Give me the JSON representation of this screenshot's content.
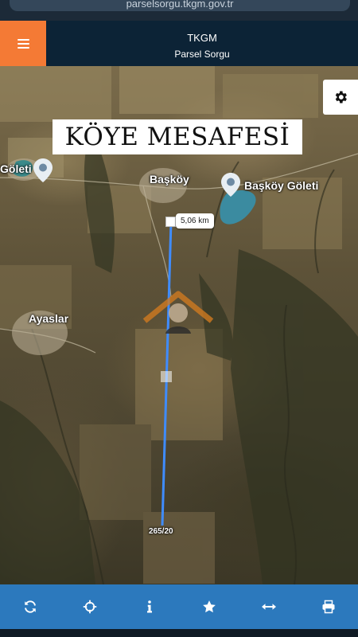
{
  "browser": {
    "url_text": "parselsorgu.tkgm.gov.tr"
  },
  "header": {
    "title": "TKGM",
    "subtitle": "Parsel Sorgu",
    "menu_icon": "hamburger-menu-icon",
    "menu_color": "#f47a35",
    "background_color": "#0c2336"
  },
  "map": {
    "banner_text": "KÖYE MESAFESİ",
    "places": [
      {
        "id": "goleti-west",
        "label": "Göleti"
      },
      {
        "id": "baskoy",
        "label": "Başköy"
      },
      {
        "id": "baskoy-goleti",
        "label": "Başköy Göleti"
      },
      {
        "id": "ayaslar",
        "label": "Ayaslar"
      }
    ],
    "measurement": {
      "distance": "5,06 km",
      "line_color": "#3f8cff"
    },
    "parcel_label": "265/20",
    "settings_icon": "gear-icon"
  },
  "toolbar": {
    "background_color": "#2c79bd",
    "buttons": [
      {
        "name": "refresh",
        "icon": "refresh-icon"
      },
      {
        "name": "locate",
        "icon": "crosshair-icon"
      },
      {
        "name": "info",
        "icon": "info-icon"
      },
      {
        "name": "favorite",
        "icon": "star-icon"
      },
      {
        "name": "measure",
        "icon": "measure-arrows-icon"
      },
      {
        "name": "print",
        "icon": "printer-icon"
      }
    ]
  }
}
